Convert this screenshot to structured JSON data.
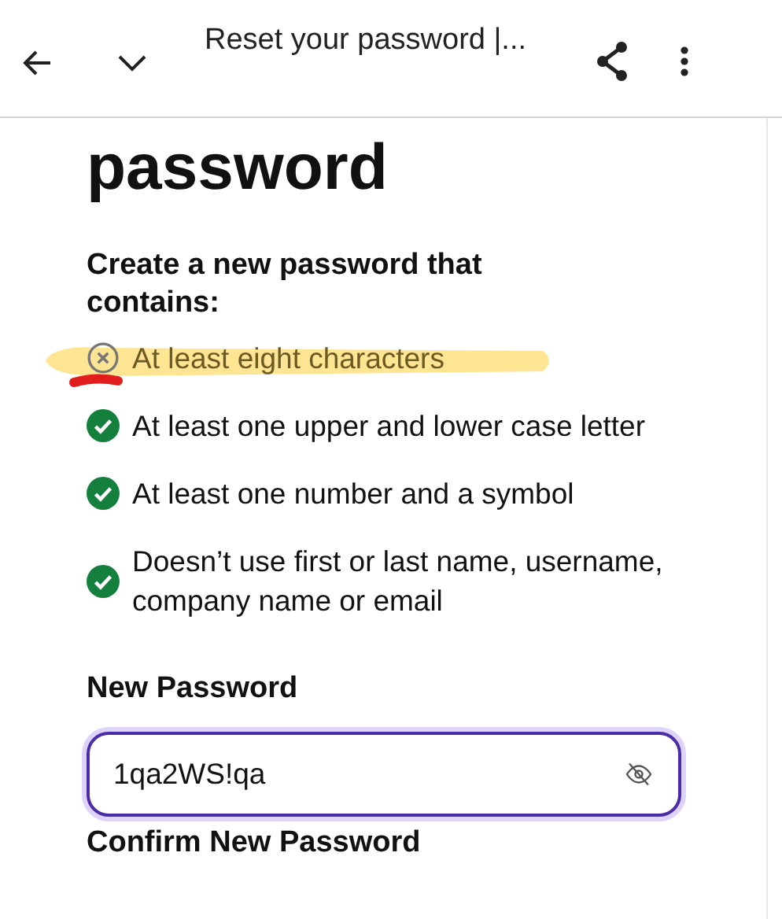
{
  "toolbar": {
    "title": "Reset your password |..."
  },
  "heading": "password",
  "intro": "Create a new password that contains:",
  "requirements": [
    {
      "text": "At least eight characters",
      "met": false,
      "highlighted": true
    },
    {
      "text": "At least one upper and lower case letter",
      "met": true,
      "highlighted": false
    },
    {
      "text": "At least one number and a symbol",
      "met": true,
      "highlighted": false
    },
    {
      "text": "Doesn’t use first or last name, username, company name or email",
      "met": true,
      "highlighted": false
    }
  ],
  "new_password": {
    "label": "New Password",
    "value": "1qa2WS!qa",
    "focused": true
  },
  "confirm_password": {
    "label": "Confirm New Password"
  }
}
